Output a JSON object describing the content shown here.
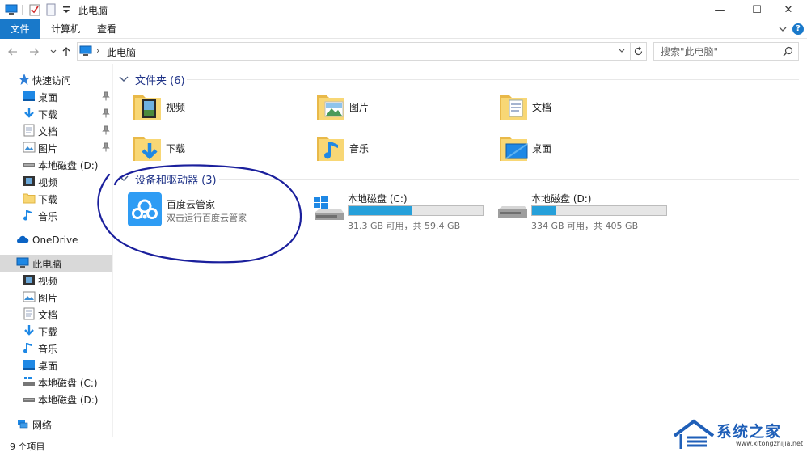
{
  "titlebar": {
    "title": "此电脑",
    "minimize": "—",
    "maximize": "☐",
    "close": "✕"
  },
  "ribbon": {
    "tabs": [
      "文件",
      "计算机",
      "查看"
    ],
    "help": "?"
  },
  "address": {
    "crumb_sep": "›",
    "path": "此电脑",
    "search_placeholder": "搜索\"此电脑\""
  },
  "sidebar": {
    "quick_access": "快速访问",
    "quick_items": [
      "桌面",
      "下载",
      "文档",
      "图片",
      "本地磁盘 (D:)",
      "视频",
      "下载",
      "音乐"
    ],
    "onedrive": "OneDrive",
    "this_pc": "此电脑",
    "pc_items": [
      "视频",
      "图片",
      "文档",
      "下载",
      "音乐",
      "桌面",
      "本地磁盘 (C:)",
      "本地磁盘 (D:)"
    ],
    "network": "网络"
  },
  "content": {
    "folders_header": "文件夹 (6)",
    "folders": [
      "视频",
      "图片",
      "文档",
      "下载",
      "音乐",
      "桌面"
    ],
    "devices_header": "设备和驱动器 (3)",
    "app": {
      "name": "百度云管家",
      "desc": "双击运行百度云管家"
    },
    "drives": [
      {
        "name": "本地磁盘 (C:)",
        "free": "31.3 GB 可用，共 59.4 GB",
        "used_fraction": 0.473
      },
      {
        "name": "本地磁盘 (D:)",
        "free": "334 GB 可用，共 405 GB",
        "used_fraction": 0.175
      }
    ]
  },
  "status": {
    "count": "9 个项目"
  },
  "watermark": {
    "text": "系统之家",
    "url": "www.xitongzhijia.net"
  },
  "colors": {
    "accent": "#1979ca",
    "folder": "#f8d775",
    "drive_fill": "#26a0da",
    "group_title": "#1e3287",
    "annotation": "#1a1f9c"
  }
}
